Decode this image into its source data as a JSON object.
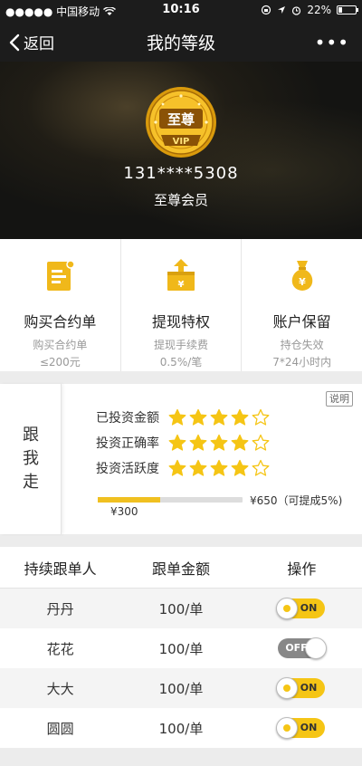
{
  "status_bar": {
    "carrier": "●●●●● 中国移动",
    "time": "10:16",
    "battery_pct": "22%"
  },
  "nav": {
    "back_label": "返回",
    "title": "我的等级",
    "more_label": "•••"
  },
  "profile": {
    "badge_text": "至尊",
    "badge_sub": "VIP",
    "phone": "131****5308",
    "level": "至尊会员"
  },
  "privileges": [
    {
      "icon": "contract-icon",
      "name": "购买合约单",
      "desc1": "购买合约单",
      "desc2": "≤200元"
    },
    {
      "icon": "withdraw-icon",
      "name": "提现特权",
      "desc1": "提现手续费",
      "desc2": "0.5%/笔"
    },
    {
      "icon": "money-bag-icon",
      "name": "账户保留",
      "desc1": "持仓失效",
      "desc2": "7*24小时内"
    }
  ],
  "follow": {
    "side_title": "跟我走",
    "explain_label": "说明",
    "ratings": [
      {
        "label": "已投资金额",
        "stars": 4,
        "max": 5
      },
      {
        "label": "投资正确率",
        "stars": 4,
        "max": 5
      },
      {
        "label": "投资活跃度",
        "stars": 4,
        "max": 5
      }
    ],
    "progress": {
      "current_label": "¥300",
      "target_label": "¥650（可提成5%)",
      "fraction": 0.43
    }
  },
  "table": {
    "headers": [
      "持续跟单人",
      "跟单金额",
      "操作"
    ],
    "rows": [
      {
        "name": "丹丹",
        "amount": "100/单",
        "toggle": "ON"
      },
      {
        "name": "花花",
        "amount": "100/单",
        "toggle": "OFF"
      },
      {
        "name": "大大",
        "amount": "100/单",
        "toggle": "ON"
      },
      {
        "name": "圆圆",
        "amount": "100/单",
        "toggle": "ON"
      }
    ]
  },
  "colors": {
    "accent": "#f5c515",
    "bar_bg": "#1c1c1c"
  }
}
